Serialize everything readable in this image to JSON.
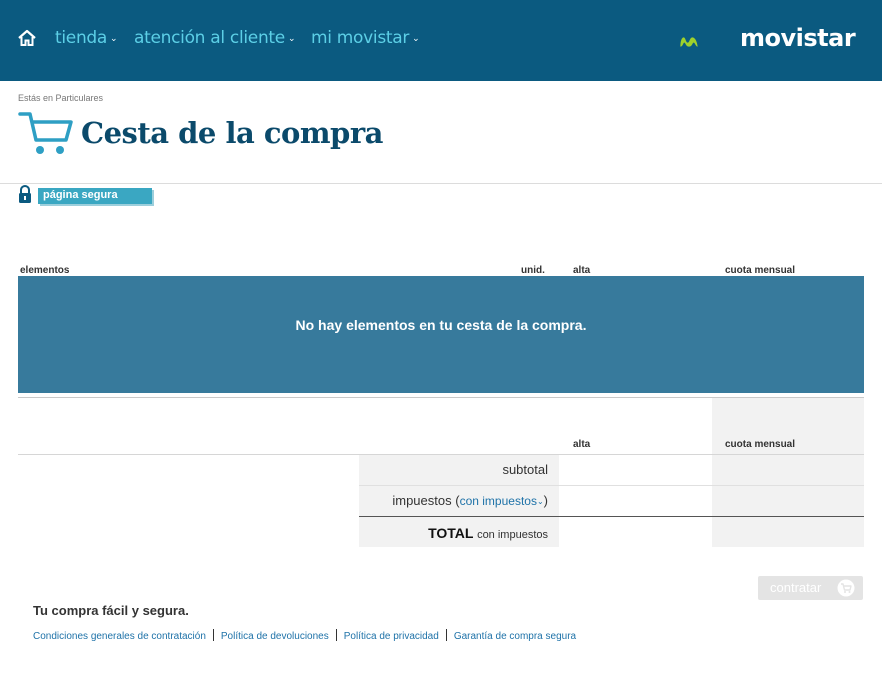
{
  "header": {
    "nav": [
      {
        "label": "tienda"
      },
      {
        "label": "atención al cliente"
      },
      {
        "label": "mi movistar"
      }
    ],
    "logo_text": "movistar",
    "colors": {
      "bar": "#0b5a80",
      "nav_text": "#5ccfe6",
      "logo_green": "#9fd12c"
    }
  },
  "breadcrumb": "Estás en Particulares",
  "page_title": "Cesta de la compra",
  "secure_label": "página segura",
  "table": {
    "headers": {
      "elements": "elementos",
      "units": "unid.",
      "alta": "alta",
      "monthly": "cuota mensual"
    },
    "empty_message": "No hay elementos en tu cesta de la compra.",
    "summary_headers": {
      "alta": "alta",
      "monthly": "cuota mensual"
    },
    "subtotal_label": "subtotal",
    "taxes_label": "impuestos",
    "taxes_paren_open": "(",
    "taxes_link": "con impuestos",
    "taxes_paren_close": ")",
    "total_label": "TOTAL",
    "total_sub": "con impuestos"
  },
  "contratar_label": "contratar",
  "footer": {
    "title": "Tu compra fácil y segura.",
    "links": [
      {
        "label": "Condiciones generales de contratación"
      },
      {
        "label": "Política de devoluciones"
      },
      {
        "label": "Política de privacidad"
      },
      {
        "label": "Garantía de compra segura"
      }
    ]
  }
}
